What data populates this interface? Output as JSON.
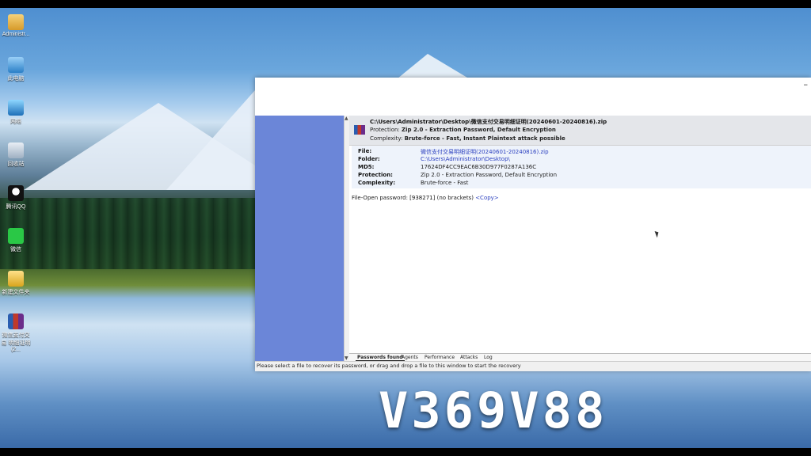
{
  "desktop_icons": [
    {
      "label": "Administr...",
      "icon": "user-folder-icon"
    },
    {
      "label": "此电脑",
      "icon": "computer-icon"
    },
    {
      "label": "网络",
      "icon": "network-icon"
    },
    {
      "label": "回收站",
      "icon": "recycle-bin-icon"
    },
    {
      "label": "腾讯QQ",
      "icon": "qq-icon"
    },
    {
      "label": "微信",
      "icon": "wechat-icon"
    },
    {
      "label": "新建文件夹",
      "icon": "folder-icon"
    },
    {
      "label": "微信支付交易 明细证明(2...",
      "icon": "rar-archive-icon"
    }
  ],
  "window": {
    "minimize_glyph": "–",
    "header": {
      "path": "C:\\Users\\Administrator\\Desktop\\微信支付交易明细证明(20240601-20240816).zip",
      "protection_label": "Protection:",
      "protection_value": "Zip 2.0 - Extraction Password, Default Encryption",
      "complexity_label": "Complexity:",
      "complexity_value": "Brute-force - Fast, Instant Plaintext attack possible"
    },
    "details": [
      {
        "key": "File:",
        "value": "微信支付交易明细证明(20240601-20240816).zip",
        "link": true
      },
      {
        "key": "Folder:",
        "value": "C:\\Users\\Administrator\\Desktop\\",
        "link": true
      },
      {
        "key": "MD5:",
        "value": "17624DF4CC9EAC6B30D977F0287A136C",
        "link": false
      },
      {
        "key": "Protection:",
        "value": "Zip 2.0 - Extraction Password, Default Encryption",
        "link": false
      },
      {
        "key": "Complexity:",
        "value": "Brute-force - Fast",
        "link": false
      }
    ],
    "password_line": {
      "prefix": "File-Open password: ",
      "password": "[938271]",
      "suffix": " (no brackets) ",
      "copy_label": "<Copy>"
    },
    "tabs": [
      "Passwords found",
      "Agents",
      "Performance",
      "Attacks",
      "Log"
    ],
    "active_tab": "Passwords found",
    "status": "Please select a file to recover its password, or drag and drop a file to this window to start the recovery"
  },
  "caption": "V369V88"
}
